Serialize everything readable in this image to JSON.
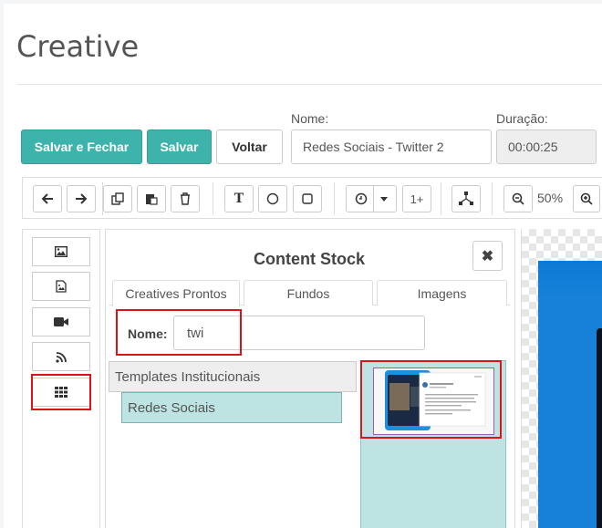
{
  "page": {
    "title": "Creative"
  },
  "actions": {
    "save_close": "Salvar e Fechar",
    "save": "Salvar",
    "back": "Voltar"
  },
  "form": {
    "name_label": "Nome:",
    "name_value": "Redes Sociais - Twitter 2",
    "duration_label": "Duração:",
    "duration_value": "00:00:25"
  },
  "toolbar": {
    "counter_label": "1+",
    "zoom": "50%"
  },
  "sidebar": {
    "items": [
      {
        "icon": "image-icon"
      },
      {
        "icon": "file-image-icon"
      },
      {
        "icon": "video-camera-icon"
      },
      {
        "icon": "rss-icon"
      },
      {
        "icon": "grid-icon"
      }
    ]
  },
  "content_stock": {
    "title": "Content Stock",
    "tabs": [
      "Creatives Prontos",
      "Fundos",
      "Imagens"
    ],
    "search_label": "Nome:",
    "search_value": "twi",
    "categories": [
      {
        "label": "Templates Institucionais"
      },
      {
        "label": "Redes Sociais"
      }
    ]
  },
  "colors": {
    "accent": "#3db3ac",
    "highlight": "#d9141b",
    "selection": "#bde3e3",
    "canvas": "#1781d9"
  }
}
